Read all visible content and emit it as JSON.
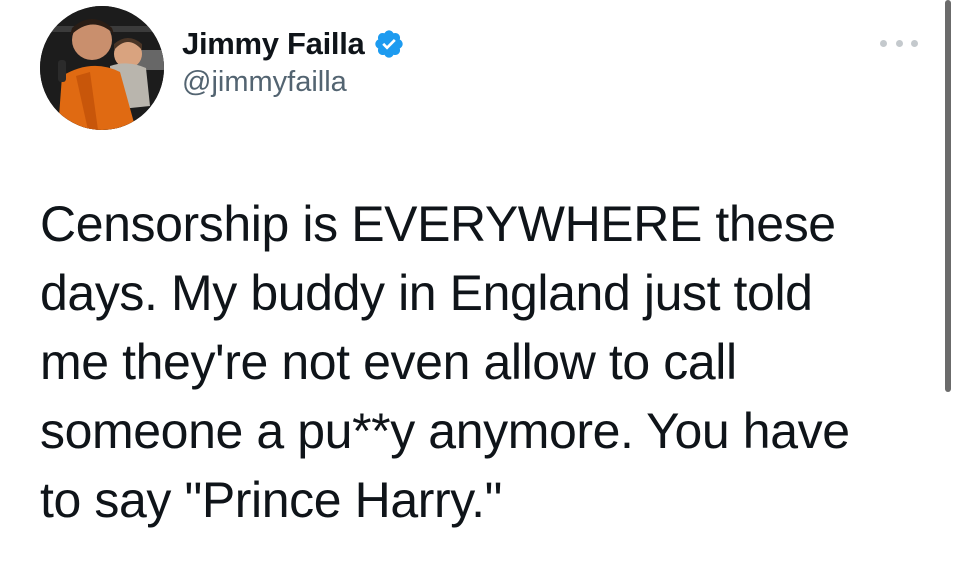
{
  "user": {
    "display_name": "Jimmy Failla",
    "handle": "@jimmyfailla",
    "verified": true,
    "verified_icon": "verified-badge-icon",
    "verified_color": "#1d9bf0"
  },
  "menu": {
    "icon": "more-options-icon"
  },
  "tweet": {
    "lines": [
      "Censorship is EVERYWHERE these",
      "days. My buddy in England just told",
      "me they're not even allow to call",
      "someone a pu**y anymore. You have",
      "to say \"Prince Harry.\""
    ]
  },
  "colors": {
    "text": "#0f1419",
    "secondary_text": "#536471",
    "background": "#ffffff"
  }
}
